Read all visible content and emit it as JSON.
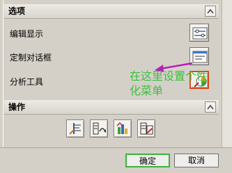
{
  "options_section": {
    "title": "选项",
    "rows": [
      {
        "label": "编辑显示",
        "icon": "edit-display-icon"
      },
      {
        "label": "定制对话框",
        "icon": "customize-dialog-icon"
      },
      {
        "label": "分析工具",
        "icon": "analysis-tool-icon"
      }
    ]
  },
  "annotation": {
    "text_line1": "在这里设置个性",
    "text_line2": "化菜单",
    "color": "#3fbf3f",
    "arrow_color": "#b81fb8"
  },
  "operations_section": {
    "title": "操作",
    "buttons": [
      {
        "icon": "operation-icon-1"
      },
      {
        "icon": "operation-icon-2"
      },
      {
        "icon": "operation-icon-3"
      },
      {
        "icon": "operation-icon-4"
      }
    ]
  },
  "footer": {
    "ok_label": "确定",
    "cancel_label": "取消"
  }
}
